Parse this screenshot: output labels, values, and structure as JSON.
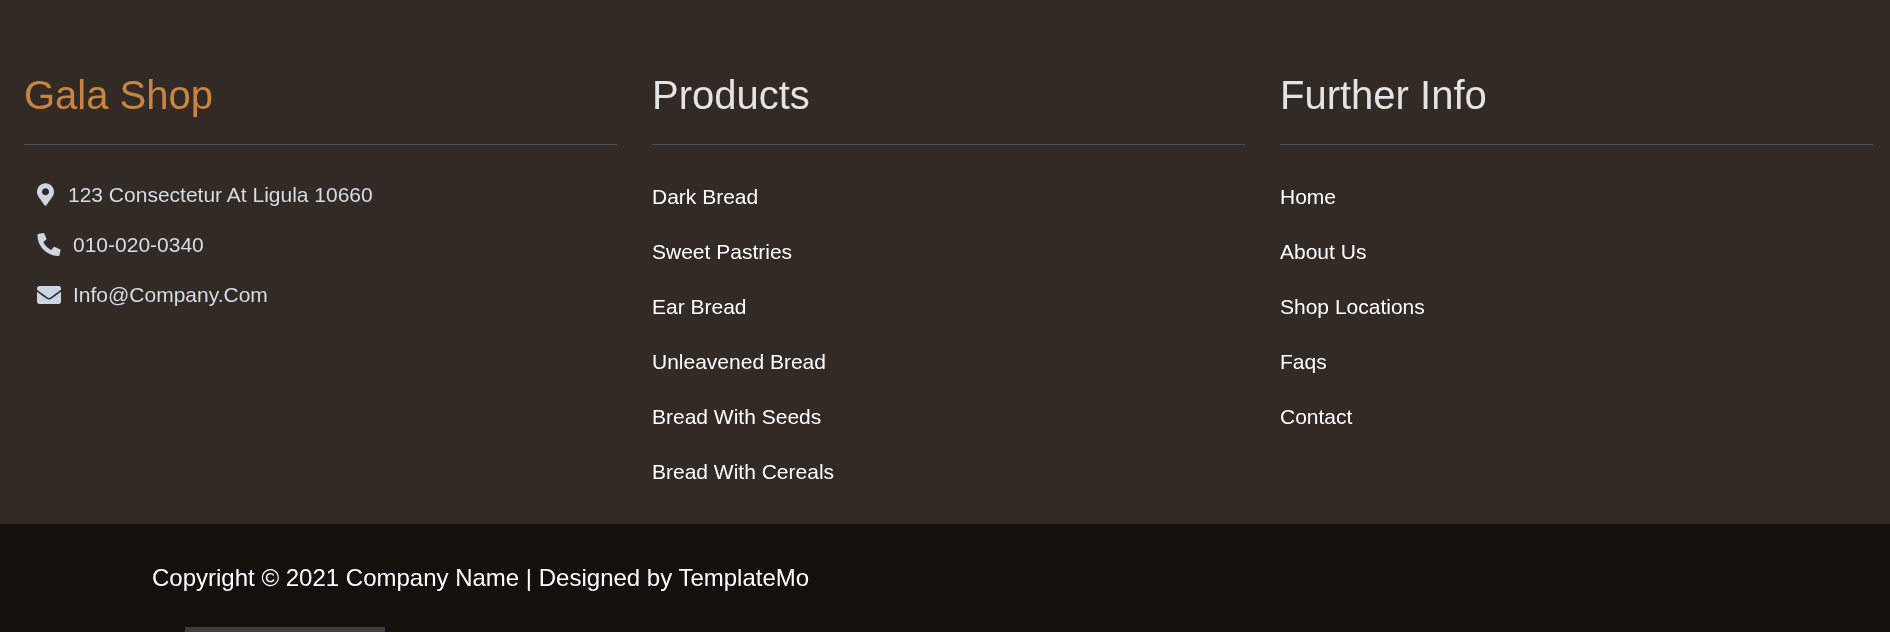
{
  "brand": {
    "title": "Gala Shop",
    "contacts": [
      {
        "kind": "address",
        "text": "123 Consectetur At Ligula 10660"
      },
      {
        "kind": "phone",
        "text": "010-020-0340"
      },
      {
        "kind": "email",
        "text": "Info@Company.Com"
      }
    ]
  },
  "columns": [
    {
      "title": "Products",
      "links": [
        "Dark Bread",
        "Sweet Pastries",
        "Ear Bread",
        "Unleavened Bread",
        "Bread With Seeds",
        "Bread With Cereals"
      ]
    },
    {
      "title": "Further Info",
      "links": [
        "Home",
        "About Us",
        "Shop Locations",
        "Faqs",
        "Contact"
      ]
    }
  ],
  "copyright": "Copyright © 2021 Company Name | Designed by TemplateMo"
}
